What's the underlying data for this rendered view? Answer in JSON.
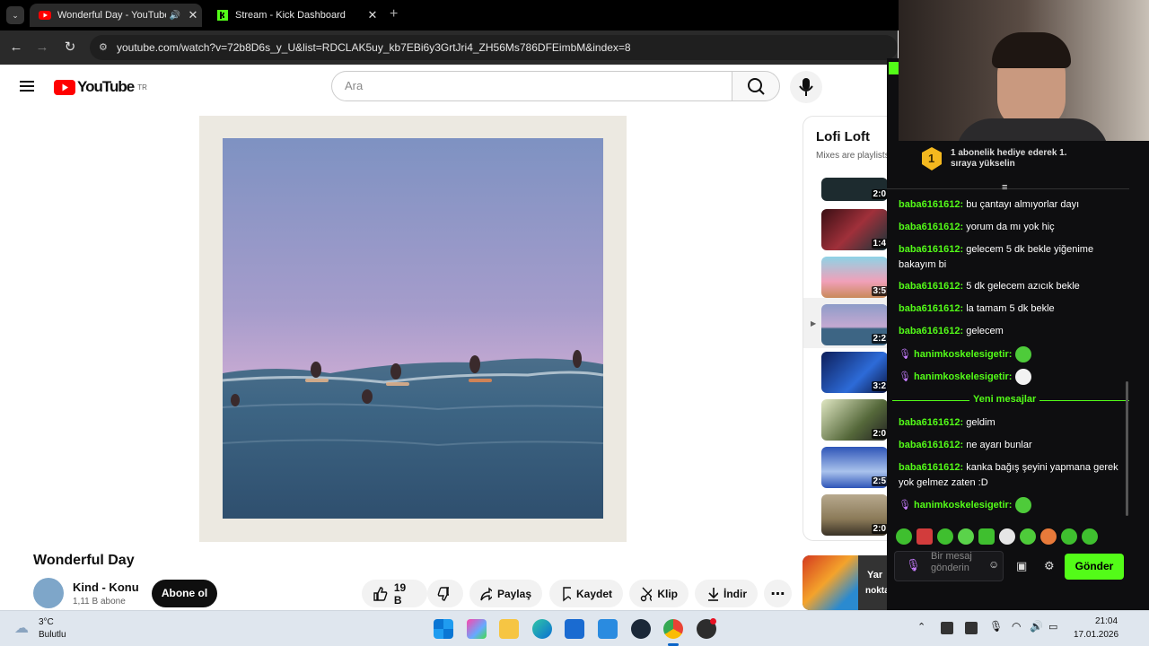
{
  "browser": {
    "tabs": [
      {
        "title": "Wonderful Day - YouTube"
      },
      {
        "title": "Stream - Kick Dashboard"
      }
    ],
    "url": "youtube.com/watch?v=72b8D6s_y_U&list=RDCLAK5uy_kb7EBi6y3GrtJri4_ZH56Ms786DFEimbM&index=8"
  },
  "youtube": {
    "logo_text": "YouTube",
    "region": "TR",
    "search_placeholder": "Ara",
    "video_title": "Wonderful Day",
    "channel_name": "Kind - Konu",
    "channel_subs": "1,11 B abone",
    "subscribe_label": "Abone ol",
    "likes": "19 B",
    "share_label": "Paylaş",
    "save_label": "Kaydet",
    "clip_label": "Klip",
    "download_label": "İndir",
    "playlist_title": "Lofi Loft",
    "playlist_subtitle": "Mixes are playlists",
    "durations": [
      "2:0",
      "1:4",
      "3:5",
      "2:2",
      "3:2",
      "2:0",
      "2:5",
      "2:0"
    ],
    "ad_text_1": "Yar",
    "ad_text_2": "nokta. şimdi video"
  },
  "kick": {
    "gift_rank": "1",
    "gift_text": "1 abonelik hediye ederek 1. sıraya yükselin",
    "messages": [
      {
        "user": "baba6161612:",
        "text": "bu çantayı almıyorlar dayı"
      },
      {
        "user": "baba6161612:",
        "text": "yorum da mı yok hiç"
      },
      {
        "user": "baba6161612:",
        "text": "gelecem 5 dk bekle yiğenime bakayım bi"
      },
      {
        "user": "baba6161612:",
        "text": "5 dk gelecem azıcık bekle"
      },
      {
        "user": "baba6161612:",
        "text": "la tamam 5 dk bekle"
      },
      {
        "user": "baba6161612:",
        "text": "gelecem"
      },
      {
        "user": "hanimkoskelesigetir:",
        "text": ""
      },
      {
        "user": "hanimkoskelesigetir:",
        "text": ""
      },
      {
        "user": "baba6161612:",
        "text": "geldim"
      },
      {
        "user": "baba6161612:",
        "text": "ne ayarı bunlar"
      },
      {
        "user": "baba6161612:",
        "text": "kanka bağış şeyini yapmana gerek yok gelmez zaten :D"
      },
      {
        "user": "hanimkoskelesigetir:",
        "text": ""
      }
    ],
    "new_messages_label": "Yeni mesajlar",
    "input_placeholder": "Bir mesaj gönderin",
    "send_label": "Gönder"
  },
  "taskbar": {
    "temp": "3°C",
    "weather": "Bulutlu",
    "time": "21:04",
    "date": "17.01.2026"
  },
  "colors": {
    "kick_green": "#53fc18",
    "yt_red": "#ff0000"
  }
}
